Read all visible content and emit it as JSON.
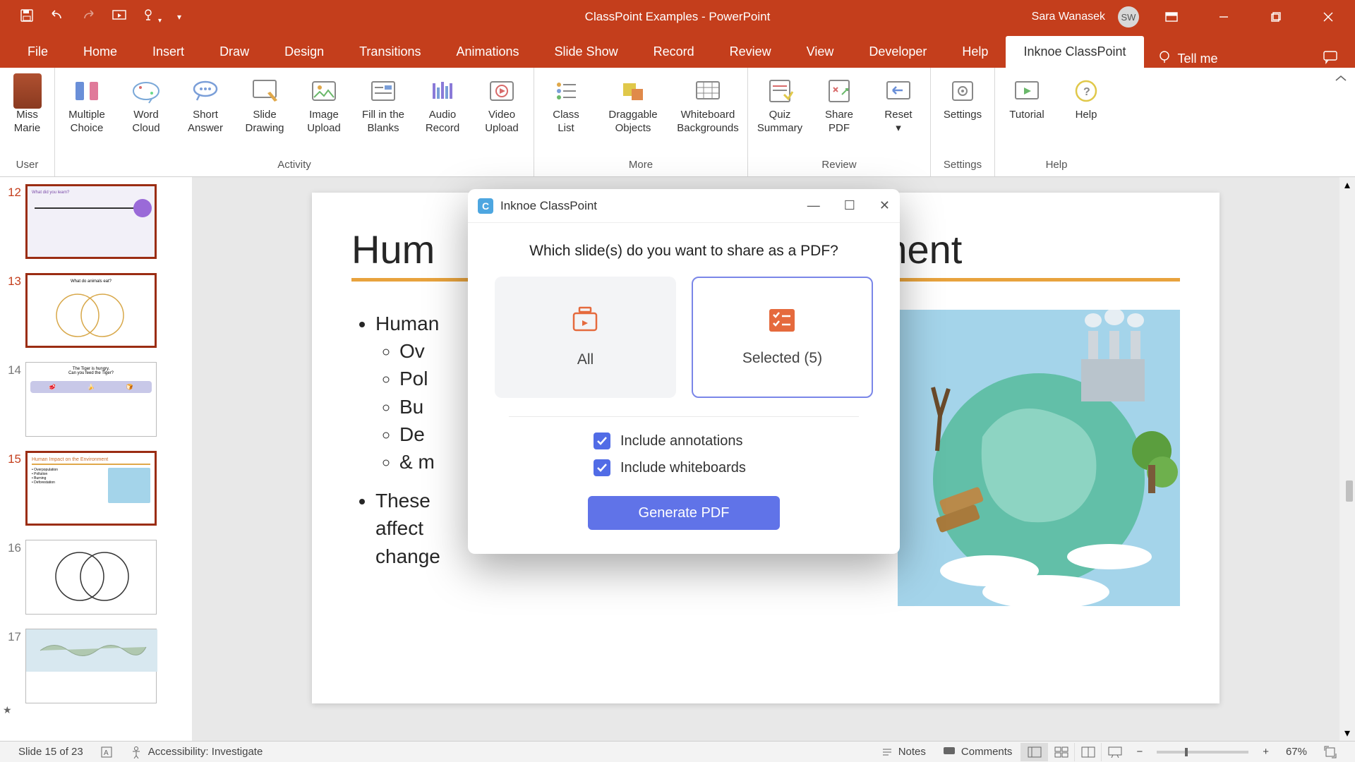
{
  "titlebar": {
    "doc": "ClassPoint Examples  -  PowerPoint",
    "user_name": "Sara Wanasek",
    "user_initials": "SW"
  },
  "tabs": {
    "items": [
      "File",
      "Home",
      "Insert",
      "Draw",
      "Design",
      "Transitions",
      "Animations",
      "Slide Show",
      "Record",
      "Review",
      "View",
      "Developer",
      "Help",
      "Inknoe ClassPoint"
    ],
    "active": "Inknoe ClassPoint",
    "tell_me": "Tell me"
  },
  "ribbon": {
    "groups": {
      "user": {
        "label": "User",
        "items": [
          {
            "label": "Miss\nMarie"
          }
        ]
      },
      "activity": {
        "label": "Activity",
        "items": [
          {
            "label": "Multiple\nChoice"
          },
          {
            "label": "Word\nCloud"
          },
          {
            "label": "Short\nAnswer"
          },
          {
            "label": "Slide\nDrawing"
          },
          {
            "label": "Image\nUpload"
          },
          {
            "label": "Fill in the\nBlanks"
          },
          {
            "label": "Audio\nRecord"
          },
          {
            "label": "Video\nUpload"
          }
        ]
      },
      "more": {
        "label": "More",
        "items": [
          {
            "label": "Class\nList"
          },
          {
            "label": "Draggable\nObjects"
          },
          {
            "label": "Whiteboard\nBackgrounds"
          }
        ]
      },
      "review": {
        "label": "Review",
        "items": [
          {
            "label": "Quiz\nSummary"
          },
          {
            "label": "Share\nPDF"
          },
          {
            "label": "Reset\n▾"
          }
        ]
      },
      "settings": {
        "label": "Settings",
        "items": [
          {
            "label": "Settings"
          }
        ]
      },
      "help": {
        "label": "Help",
        "items": [
          {
            "label": "Tutorial"
          },
          {
            "label": "Help"
          }
        ]
      }
    }
  },
  "thumbs": [
    {
      "n": "12",
      "sel": true
    },
    {
      "n": "13",
      "sel": true
    },
    {
      "n": "14",
      "sel": false
    },
    {
      "n": "15",
      "sel": true
    },
    {
      "n": "16",
      "sel": false
    },
    {
      "n": "17",
      "sel": false,
      "star": true
    }
  ],
  "slide": {
    "title_left": "Hum",
    "title_right": "ment",
    "full_title": "Human Impact on the Environment",
    "bullets": {
      "lead": "Human",
      "subs": [
        "Ov",
        "Pol",
        "Bu",
        "De",
        "& m"
      ],
      "trail1": "These",
      "trail2": "affect",
      "trail3": "change"
    }
  },
  "dialog": {
    "title": "Inknoe ClassPoint",
    "question": "Which slide(s) do you want to share as a PDF?",
    "opt_all": "All",
    "opt_sel": "Selected (5)",
    "chk1": "Include annotations",
    "chk2": "Include whiteboards",
    "btn": "Generate PDF"
  },
  "status": {
    "slide": "Slide 15 of 23",
    "access": "Accessibility: Investigate",
    "notes": "Notes",
    "comments": "Comments",
    "zoom": "67%"
  }
}
